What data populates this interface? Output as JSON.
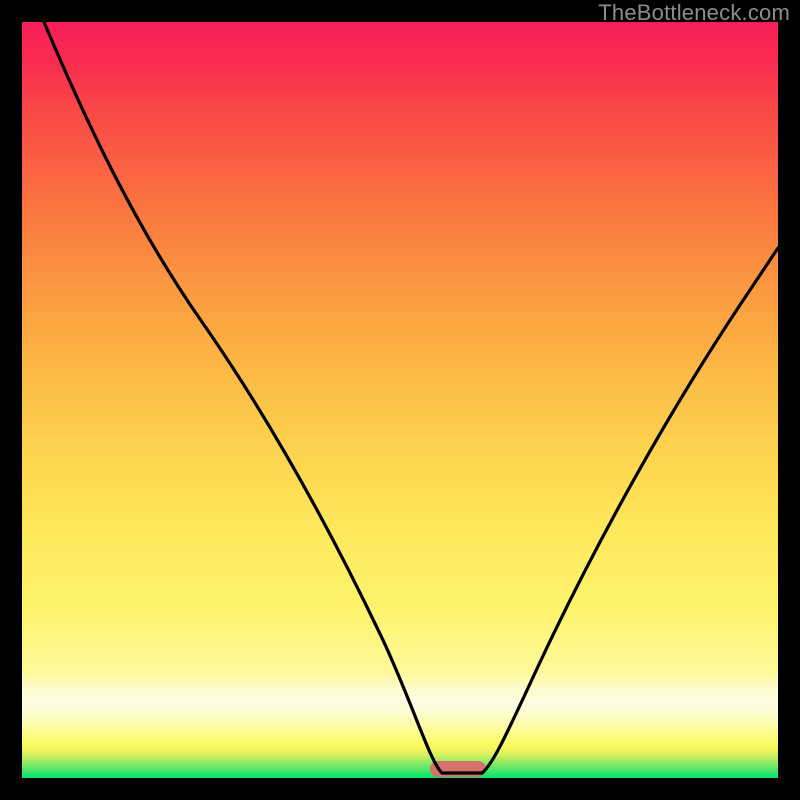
{
  "watermark": "TheBottleneck.com",
  "chart_data": {
    "type": "line",
    "title": "",
    "xlabel": "",
    "ylabel": "",
    "xlim": [
      0,
      100
    ],
    "ylim": [
      0,
      100
    ],
    "grid": false,
    "legend": false,
    "series": [
      {
        "name": "bottleneck-curve",
        "x": [
          3,
          10,
          20,
          28,
          35,
          42,
          48,
          53,
          55,
          57,
          60,
          63,
          66,
          72,
          80,
          90,
          100
        ],
        "y": [
          100,
          84,
          68,
          58,
          47,
          35,
          23,
          10,
          2,
          0.5,
          0.5,
          2,
          8,
          20,
          36,
          54,
          70
        ]
      }
    ],
    "marker": {
      "name": "optimal-range",
      "x_start": 55,
      "x_end": 62,
      "color": "#d67169"
    },
    "background_gradient": {
      "top": "#f71e5a",
      "upper_mid": "#fb9540",
      "mid": "#fef46e",
      "lower_mid": "#fefce2",
      "bottom": "#00e46f"
    }
  }
}
